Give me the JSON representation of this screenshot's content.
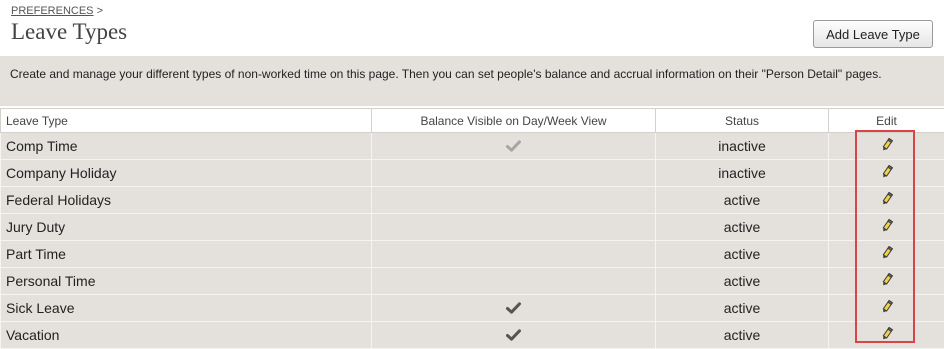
{
  "breadcrumb": {
    "link": "PREFERENCES",
    "separator": ">"
  },
  "page_title": "Leave Types",
  "add_button_label": "Add Leave Type",
  "description": "Create and manage your different types of non-worked time on this page. Then you can set people's balance and accrual information on their \"Person Detail\" pages.",
  "table": {
    "headers": [
      "Leave Type",
      "Balance Visible on Day/Week View",
      "Status",
      "Edit"
    ],
    "rows": [
      {
        "name": "Comp Time",
        "balance_visible": true,
        "check_style": "disabled",
        "status": "inactive"
      },
      {
        "name": "Company Holiday",
        "balance_visible": false,
        "check_style": "",
        "status": "inactive"
      },
      {
        "name": "Federal Holidays",
        "balance_visible": false,
        "check_style": "",
        "status": "active"
      },
      {
        "name": "Jury Duty",
        "balance_visible": false,
        "check_style": "",
        "status": "active"
      },
      {
        "name": "Part Time",
        "balance_visible": false,
        "check_style": "",
        "status": "active"
      },
      {
        "name": "Personal Time",
        "balance_visible": false,
        "check_style": "",
        "status": "active"
      },
      {
        "name": "Sick Leave",
        "balance_visible": true,
        "check_style": "enabled",
        "status": "active"
      },
      {
        "name": "Vacation",
        "balance_visible": true,
        "check_style": "enabled",
        "status": "active"
      }
    ]
  },
  "colors": {
    "row_bg": "#e4e1dd",
    "highlight_border": "#d9434a",
    "check_enabled": "#555555",
    "check_disabled": "#a6a6a6",
    "pencil_fill": "#f2d24a"
  },
  "icons": {
    "edit": "pencil-icon",
    "balance": "checkmark-icon"
  }
}
